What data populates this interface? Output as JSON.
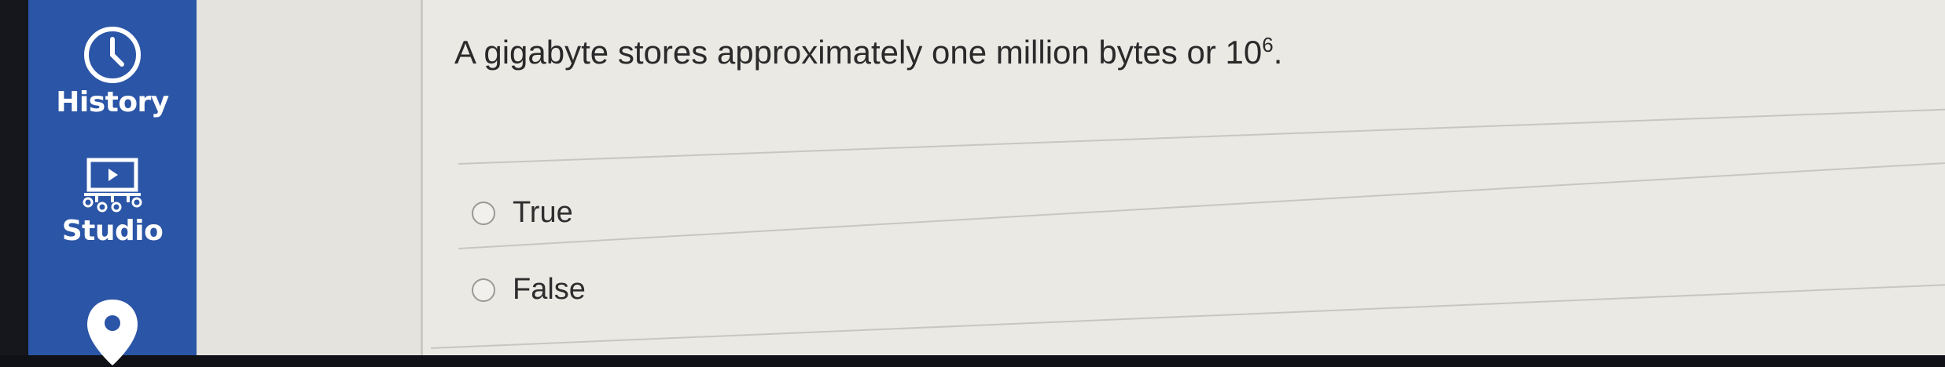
{
  "sidebar": {
    "items": [
      {
        "label": "History",
        "icon": "clock-icon"
      },
      {
        "label": "Studio",
        "icon": "studio-icon"
      },
      {
        "label": "",
        "icon": "location-pin-icon"
      }
    ]
  },
  "question": {
    "text": "A gigabyte stores approximately one million bytes or 10",
    "exponent": "6",
    "end": "."
  },
  "options": [
    {
      "label": "True",
      "selected": false
    },
    {
      "label": "False",
      "selected": false
    }
  ],
  "colors": {
    "sidebar": "#2b55a6",
    "panel": "#eae9e4",
    "text": "#2a2a2a"
  }
}
